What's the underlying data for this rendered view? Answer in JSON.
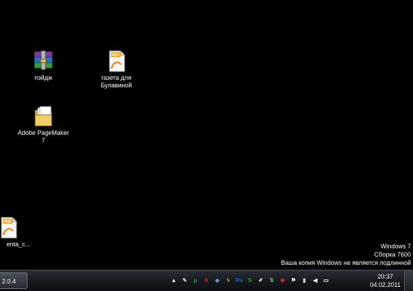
{
  "desktop_icons": [
    {
      "label": "пэйдж",
      "icon": "winrar-archive-icon"
    },
    {
      "label": "газета для Булавиной",
      "icon": "pdf-document-icon"
    },
    {
      "label": "Adobe PageMaker 7",
      "icon": "folder-icon"
    },
    {
      "label": "enta_c...",
      "icon": "pdf-document-icon"
    }
  ],
  "watermark": {
    "line1": "Windows 7",
    "line2": "Сборка 7600",
    "line3": "Ваша копия Windows не является подлинной"
  },
  "taskbar": {
    "task_button_label": "2.0.4",
    "tray_icons": [
      {
        "name": "show-hidden-icons",
        "glyph": "▲",
        "color": "#ffffff"
      },
      {
        "name": "utility-icon",
        "glyph": "✎",
        "color": "#d9d9d9"
      },
      {
        "name": "torrent-icon",
        "glyph": "μ",
        "color": "#2fa02f"
      },
      {
        "name": "adobe-icon",
        "glyph": "A",
        "color": "#d42020"
      },
      {
        "name": "shield-icon",
        "glyph": "◆",
        "color": "#5b9bd5"
      },
      {
        "name": "bolt-icon",
        "glyph": "ϟ",
        "color": "#e8c23a"
      },
      {
        "name": "ru-language-icon",
        "glyph": "Ru",
        "color": "#2a62c9"
      },
      {
        "name": "skype-icon",
        "glyph": "S",
        "color": "#1fa31f"
      },
      {
        "name": "pen-icon",
        "glyph": "✐",
        "color": "#cfcfcf"
      },
      {
        "name": "network-icon",
        "glyph": "⇅",
        "color": "#4fc05a"
      },
      {
        "name": "security-icon",
        "glyph": "⊕",
        "color": "#d33a3a"
      },
      {
        "name": "flag-icon",
        "glyph": "⚑",
        "color": "#ffffff"
      },
      {
        "name": "battery-icon",
        "glyph": "▮",
        "color": "#cfcfcf"
      },
      {
        "name": "volume-icon",
        "glyph": "◀",
        "color": "#ffffff"
      },
      {
        "name": "display-icon",
        "glyph": "▭",
        "color": "#ffffff"
      }
    ],
    "clock_time": "20:37",
    "clock_date": "04.02.2011"
  }
}
